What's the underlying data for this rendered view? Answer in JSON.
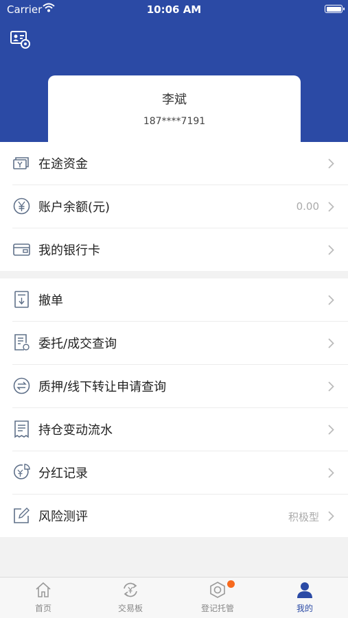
{
  "status_bar": {
    "carrier": "Carrier",
    "time": "10:06 AM"
  },
  "profile": {
    "name": "李斌",
    "phone": "187****7191"
  },
  "group1": [
    {
      "label": "在途资金",
      "value": "",
      "icon": "money-stack-icon"
    },
    {
      "label": "账户余额(元)",
      "value": "0.00",
      "icon": "yuan-circle-icon"
    },
    {
      "label": "我的银行卡",
      "value": "",
      "icon": "bank-card-icon"
    }
  ],
  "group2": [
    {
      "label": "撤单",
      "value": "",
      "icon": "cancel-order-icon"
    },
    {
      "label": "委托/成交查询",
      "value": "",
      "icon": "document-search-icon"
    },
    {
      "label": "质押/线下转让申请查询",
      "value": "",
      "icon": "transfer-arrows-icon"
    },
    {
      "label": "持仓变动流水",
      "value": "",
      "icon": "receipt-list-icon"
    },
    {
      "label": "分红记录",
      "value": "",
      "icon": "dividend-icon"
    },
    {
      "label": "风险测评",
      "value": "积极型",
      "icon": "edit-pencil-icon"
    }
  ],
  "tabbar": [
    {
      "label": "首页",
      "icon": "home-icon"
    },
    {
      "label": "交易板",
      "icon": "exchange-icon"
    },
    {
      "label": "登记托管",
      "icon": "custody-hexagon-icon"
    },
    {
      "label": "我的",
      "icon": "person-icon"
    }
  ],
  "colors": {
    "brand": "#2b4aa5",
    "badge": "#f76a1e",
    "icon_line": "#5f7089"
  }
}
